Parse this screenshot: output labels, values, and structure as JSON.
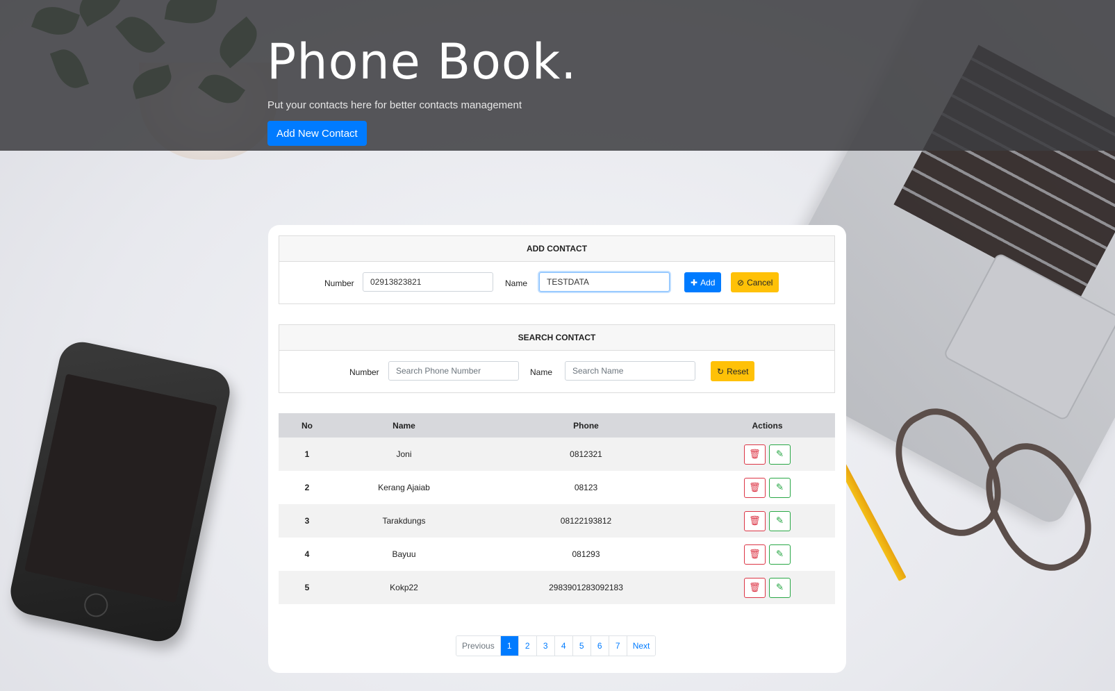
{
  "hero": {
    "title": "Phone Book.",
    "subtitle": "Put your contacts here for better contacts management",
    "add_button_label": "Add New Contact"
  },
  "add_contact": {
    "heading": "ADD CONTACT",
    "number_label": "Number",
    "number_value": "02913823821",
    "name_label": "Name",
    "name_value": "TESTDATA",
    "add_button_label": "Add",
    "cancel_button_label": "Cancel"
  },
  "search_contact": {
    "heading": "SEARCH CONTACT",
    "number_label": "Number",
    "number_placeholder": "Search Phone Number",
    "name_label": "Name",
    "name_placeholder": "Search Name",
    "reset_button_label": "Reset"
  },
  "table": {
    "headers": [
      "No",
      "Name",
      "Phone",
      "Actions"
    ],
    "rows": [
      {
        "no": "1",
        "name": "Joni",
        "phone": "0812321"
      },
      {
        "no": "2",
        "name": "Kerang Ajaiab",
        "phone": "08123"
      },
      {
        "no": "3",
        "name": "Tarakdungs",
        "phone": "08122193812"
      },
      {
        "no": "4",
        "name": "Bayuu",
        "phone": "081293"
      },
      {
        "no": "5",
        "name": "Kokp22",
        "phone": "2983901283092183"
      }
    ]
  },
  "pagination": {
    "previous_label": "Previous",
    "pages": [
      "1",
      "2",
      "3",
      "4",
      "5",
      "6",
      "7"
    ],
    "active_page": "1",
    "next_label": "Next"
  },
  "icons": {
    "add": "plus-icon",
    "cancel": "ban-icon",
    "reset": "refresh-icon",
    "delete": "trash-icon",
    "edit": "edit-icon"
  },
  "colors": {
    "primary": "#007bff",
    "warning": "#ffc107",
    "danger": "#dc3545",
    "success": "#28a745"
  }
}
